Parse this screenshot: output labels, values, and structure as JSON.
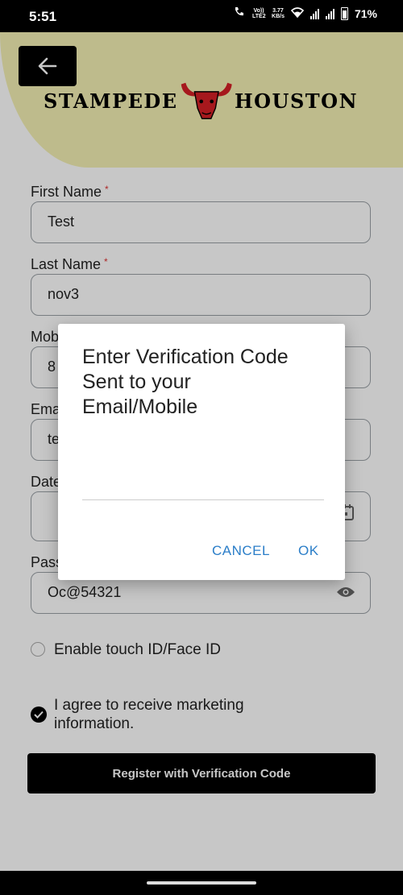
{
  "status": {
    "time": "5:51",
    "volte": "Vo)) LTE2",
    "speed_value": "3.77",
    "speed_unit": "KB/s",
    "battery": "71%"
  },
  "brand": {
    "left": "STAMPEDE",
    "right": "HOUSTON",
    "accent_color": "#d51f26"
  },
  "form": {
    "first_name_label": "First Name",
    "first_name_value": "Test",
    "last_name_label": "Last Name",
    "last_name_value": "nov3",
    "mobile_label_partial": "Mob",
    "mobile_value_partial": "8",
    "email_label_partial": "Ema",
    "email_value_partial": "te",
    "dob_label_partial": "Date",
    "password_label_partial": "Pass",
    "password_value": "Oc@54321",
    "required_mark": "*"
  },
  "options": {
    "touch_id_label": "Enable touch ID/Face ID",
    "marketing_label_line1": "I agree to receive marketing",
    "marketing_label_line2": "information."
  },
  "register_button": "Register with Verification Code",
  "dialog": {
    "title_line1": "Enter Verification Code",
    "title_line2": "Sent to your",
    "title_line3": "Email/Mobile",
    "code_value": "",
    "cancel": "CANCEL",
    "ok": "OK"
  }
}
